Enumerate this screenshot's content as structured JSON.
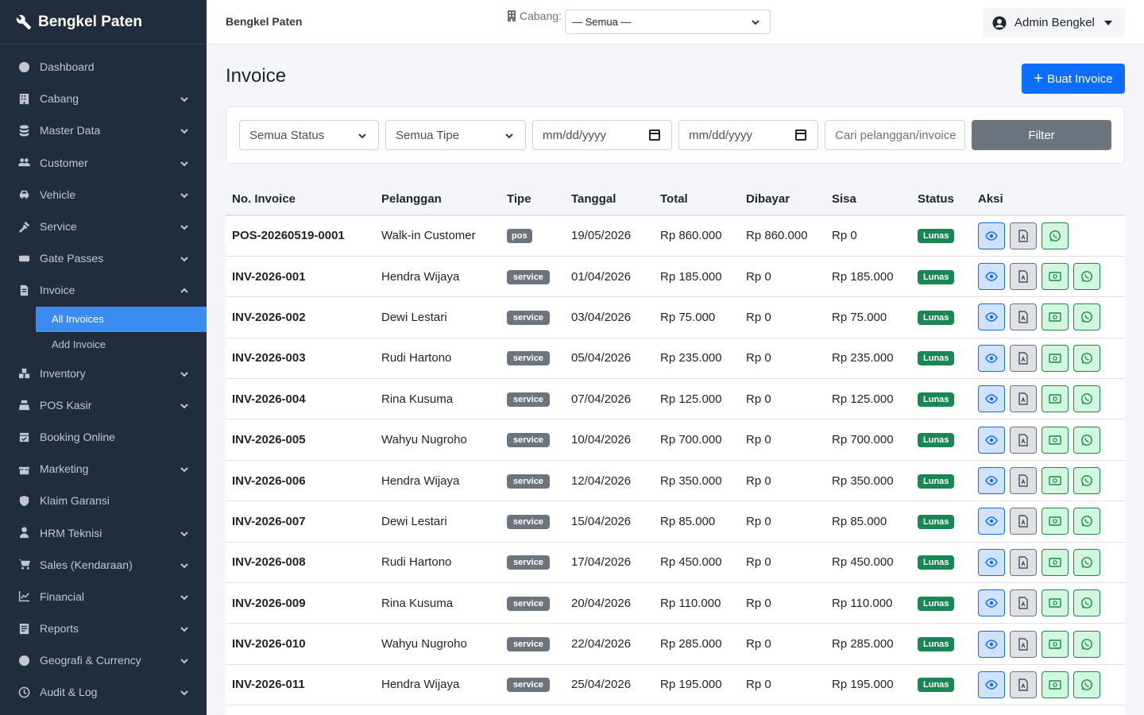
{
  "brand": {
    "name": "Bengkel Paten"
  },
  "sidebar": {
    "items": [
      {
        "label": "Dashboard",
        "icon": "dashboard-icon",
        "expand": false
      },
      {
        "label": "Cabang",
        "icon": "building-icon",
        "expand": true
      },
      {
        "label": "Master Data",
        "icon": "database-icon",
        "expand": true
      },
      {
        "label": "Customer",
        "icon": "users-icon",
        "expand": true
      },
      {
        "label": "Vehicle",
        "icon": "car-icon",
        "expand": true
      },
      {
        "label": "Service",
        "icon": "tools-icon",
        "expand": true
      },
      {
        "label": "Gate Passes",
        "icon": "ticket-icon",
        "expand": true
      },
      {
        "label": "Invoice",
        "icon": "invoice-icon",
        "expand": true,
        "open": true
      }
    ],
    "invoice_sub": [
      {
        "label": "All Invoices",
        "active": true
      },
      {
        "label": "Add Invoice",
        "active": false
      }
    ],
    "items_after": [
      {
        "label": "Inventory",
        "icon": "boxes-icon",
        "expand": true
      },
      {
        "label": "POS Kasir",
        "icon": "cash-register-icon",
        "expand": true
      },
      {
        "label": "Booking Online",
        "icon": "calendar-check-icon",
        "expand": false
      },
      {
        "label": "Marketing",
        "icon": "gift-icon",
        "expand": true
      },
      {
        "label": "Klaim Garansi",
        "icon": "shield-icon",
        "expand": false
      },
      {
        "label": "HRM Teknisi",
        "icon": "user-tie-icon",
        "expand": true
      },
      {
        "label": "Sales (Kendaraan)",
        "icon": "cart-icon",
        "expand": true
      },
      {
        "label": "Financial",
        "icon": "chart-line-icon",
        "expand": true
      },
      {
        "label": "Reports",
        "icon": "report-icon",
        "expand": true
      },
      {
        "label": "Geografi & Currency",
        "icon": "globe-icon",
        "expand": true
      },
      {
        "label": "Audit & Log",
        "icon": "history-icon",
        "expand": true
      }
    ]
  },
  "topbar": {
    "title": "Bengkel Paten",
    "branch_label": "Cabang:",
    "branch_value": "— Semua —",
    "user": "Admin Bengkel"
  },
  "page": {
    "title": "Invoice",
    "create_label": "Buat Invoice"
  },
  "filters": {
    "status": "Semua Status",
    "type": "Semua Tipe",
    "date_from": "mm/dd/yyyy",
    "date_to": "mm/dd/yyyy",
    "search_placeholder": "Cari pelanggan/invoice",
    "filter_label": "Filter"
  },
  "table": {
    "headers": [
      "No. Invoice",
      "Pelanggan",
      "Tipe",
      "Tanggal",
      "Total",
      "Dibayar",
      "Sisa",
      "Status",
      "Aksi"
    ],
    "rows": [
      {
        "no": "POS-20260519-0001",
        "customer": "Walk-in Customer",
        "type": "pos",
        "date": "19/05/2026",
        "total": "Rp 860.000",
        "paid": "Rp 860.000",
        "rest": "Rp 0",
        "status": "Lunas",
        "pay_button": false
      },
      {
        "no": "INV-2026-001",
        "customer": "Hendra Wijaya",
        "type": "service",
        "date": "01/04/2026",
        "total": "Rp 185.000",
        "paid": "Rp 0",
        "rest": "Rp 185.000",
        "status": "Lunas",
        "pay_button": true
      },
      {
        "no": "INV-2026-002",
        "customer": "Dewi Lestari",
        "type": "service",
        "date": "03/04/2026",
        "total": "Rp 75.000",
        "paid": "Rp 0",
        "rest": "Rp 75.000",
        "status": "Lunas",
        "pay_button": true
      },
      {
        "no": "INV-2026-003",
        "customer": "Rudi Hartono",
        "type": "service",
        "date": "05/04/2026",
        "total": "Rp 235.000",
        "paid": "Rp 0",
        "rest": "Rp 235.000",
        "status": "Lunas",
        "pay_button": true
      },
      {
        "no": "INV-2026-004",
        "customer": "Rina Kusuma",
        "type": "service",
        "date": "07/04/2026",
        "total": "Rp 125.000",
        "paid": "Rp 0",
        "rest": "Rp 125.000",
        "status": "Lunas",
        "pay_button": true
      },
      {
        "no": "INV-2026-005",
        "customer": "Wahyu Nugroho",
        "type": "service",
        "date": "10/04/2026",
        "total": "Rp 700.000",
        "paid": "Rp 0",
        "rest": "Rp 700.000",
        "status": "Lunas",
        "pay_button": true
      },
      {
        "no": "INV-2026-006",
        "customer": "Hendra Wijaya",
        "type": "service",
        "date": "12/04/2026",
        "total": "Rp 350.000",
        "paid": "Rp 0",
        "rest": "Rp 350.000",
        "status": "Lunas",
        "pay_button": true
      },
      {
        "no": "INV-2026-007",
        "customer": "Dewi Lestari",
        "type": "service",
        "date": "15/04/2026",
        "total": "Rp 85.000",
        "paid": "Rp 0",
        "rest": "Rp 85.000",
        "status": "Lunas",
        "pay_button": true
      },
      {
        "no": "INV-2026-008",
        "customer": "Rudi Hartono",
        "type": "service",
        "date": "17/04/2026",
        "total": "Rp 450.000",
        "paid": "Rp 0",
        "rest": "Rp 450.000",
        "status": "Lunas",
        "pay_button": true
      },
      {
        "no": "INV-2026-009",
        "customer": "Rina Kusuma",
        "type": "service",
        "date": "20/04/2026",
        "total": "Rp 110.000",
        "paid": "Rp 0",
        "rest": "Rp 110.000",
        "status": "Lunas",
        "pay_button": true
      },
      {
        "no": "INV-2026-010",
        "customer": "Wahyu Nugroho",
        "type": "service",
        "date": "22/04/2026",
        "total": "Rp 285.000",
        "paid": "Rp 0",
        "rest": "Rp 285.000",
        "status": "Lunas",
        "pay_button": true
      },
      {
        "no": "INV-2026-011",
        "customer": "Hendra Wijaya",
        "type": "service",
        "date": "25/04/2026",
        "total": "Rp 195.000",
        "paid": "Rp 0",
        "rest": "Rp 195.000",
        "status": "Lunas",
        "pay_button": true
      }
    ]
  },
  "colors": {
    "sidebar_bg": "#1f2d3d",
    "accent": "#0d6efd",
    "active_nav": "#3b8cf0",
    "success": "#198754",
    "secondary": "#6c757d"
  }
}
